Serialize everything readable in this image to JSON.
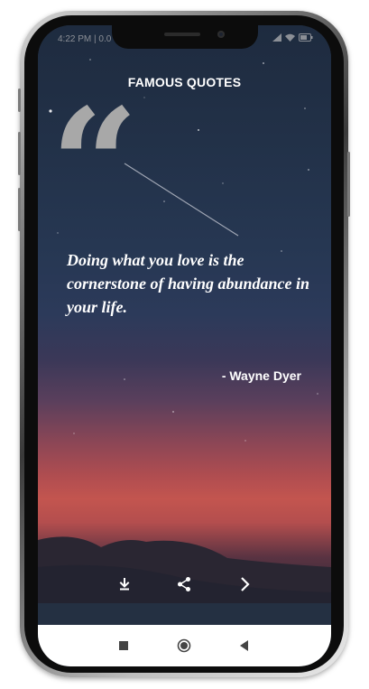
{
  "app": {
    "title": "FAMOUS QUOTES"
  },
  "status_bar": {
    "time": "4:22 PM | 0.0"
  },
  "quote": {
    "mark": "“",
    "text": "Doing what you love is the cornerstone of having abundance in your life.",
    "author": "- Wayne Dyer"
  },
  "actions": [
    {
      "name": "download",
      "icon": "download-icon"
    },
    {
      "name": "share",
      "icon": "share-icon"
    },
    {
      "name": "next",
      "icon": "chevron-right-icon"
    }
  ],
  "system_nav": [
    {
      "name": "recents",
      "icon": "square-icon"
    },
    {
      "name": "home",
      "icon": "circle-icon"
    },
    {
      "name": "back",
      "icon": "triangle-left-icon"
    }
  ],
  "colors": {
    "quote_mark": "#a8a8a8",
    "text": "#ffffff",
    "nav_bar": "#ffffff"
  }
}
